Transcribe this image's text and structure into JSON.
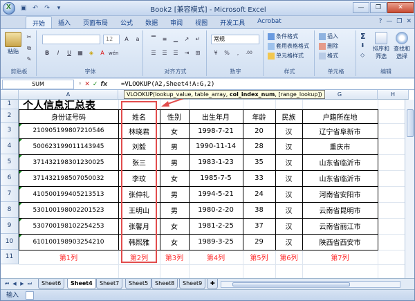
{
  "window": {
    "title": "Book2  [兼容模式]  -  Microsoft Excel",
    "office_logo": "X",
    "minimize": "—",
    "restore": "❐",
    "close": "✕"
  },
  "ribbon_tabs": [
    "开始",
    "插入",
    "页面布局",
    "公式",
    "数据",
    "审阅",
    "视图",
    "开发工具",
    "Acrobat"
  ],
  "ribbon_right_controls": [
    "?",
    "—",
    "❐",
    "✕"
  ],
  "ribbon": {
    "clipboard": {
      "paste": "粘贴",
      "label": "剪贴板"
    },
    "font": {
      "name": "",
      "size": "12",
      "bold": "B",
      "italic": "I",
      "underline": "U",
      "label": "字体",
      "font_color_glyph": "A",
      "abc": "wén"
    },
    "alignment": {
      "label": "对齐方式"
    },
    "number": {
      "format": "常规",
      "label": "数字",
      "percent": "%",
      "comma": ",",
      "dec_inc": ".00",
      "dec_dec": ".0"
    },
    "styles": {
      "cond_format": "条件格式",
      "table_format": "套用表格格式",
      "cell_style": "单元格样式",
      "label": "样式"
    },
    "cells": {
      "insert": "插入",
      "delete": "删除",
      "format": "格式",
      "label": "单元格"
    },
    "editing": {
      "sort": "排序和",
      "filter": "筛选",
      "find": "查找和",
      "select": "选择",
      "label": "编辑",
      "sigma": "Σ"
    }
  },
  "formula_bar": {
    "name_box": "SUM",
    "cancel": "✕",
    "enter": "✓",
    "fx": "fx",
    "formula": "=VLOOKUP(A2,Sheet4!A:G,2)",
    "tooltip_pre": "VLOOKUP(lookup_value, table_array, ",
    "tooltip_bold": "col_index_num",
    "tooltip_post": ", [range_lookup])"
  },
  "columns": [
    "A",
    "B",
    "C",
    "D",
    "E",
    "F",
    "G",
    "H"
  ],
  "rows": [
    "1",
    "2",
    "3",
    "4",
    "5",
    "6",
    "7",
    "8",
    "9",
    "10",
    "11"
  ],
  "sheet": {
    "title": "个人信息汇总表",
    "headers": [
      "身份证号码",
      "姓名",
      "性别",
      "出生年月",
      "年龄",
      "民族",
      "户籍所在地"
    ],
    "data": [
      [
        "210905199807210546",
        "林晓君",
        "女",
        "1998-7-21",
        "20",
        "汉",
        "辽宁省阜新市"
      ],
      [
        "500623199011143945",
        "刘毅",
        "男",
        "1990-11-14",
        "28",
        "汉",
        "重庆市"
      ],
      [
        "371432198301230025",
        "张三",
        "男",
        "1983-1-23",
        "35",
        "汉",
        "山东省临沂市"
      ],
      [
        "371432198507050032",
        "李玟",
        "女",
        "1985-7-5",
        "33",
        "汉",
        "山东省临沂市"
      ],
      [
        "410500199405213513",
        "张仲礼",
        "男",
        "1994-5-21",
        "24",
        "汉",
        "河南省安阳市"
      ],
      [
        "530100198002201523",
        "王明山",
        "男",
        "1980-2-20",
        "38",
        "汉",
        "云南省昆明市"
      ],
      [
        "530700198102254253",
        "张馨月",
        "女",
        "1981-2-25",
        "37",
        "汉",
        "云南省丽江市"
      ],
      [
        "610100198903254210",
        "韩熙雅",
        "女",
        "1989-3-25",
        "29",
        "汉",
        "陕西省西安市"
      ]
    ],
    "col_tags": [
      "第1列",
      "第2列",
      "第3列",
      "第4列",
      "第5列",
      "第6列",
      "第7列"
    ],
    "tag_color": "#ff2a2a",
    "annotation_color": "#e24c4c"
  },
  "sheet_tabs": [
    "Sheet6",
    "Sheet4",
    "Sheet7",
    "Sheet5",
    "Sheet8",
    "Sheet9"
  ],
  "sheet_nav": [
    "⏮",
    "◀",
    "▶",
    "⏭"
  ],
  "status": {
    "mode": "输入"
  }
}
